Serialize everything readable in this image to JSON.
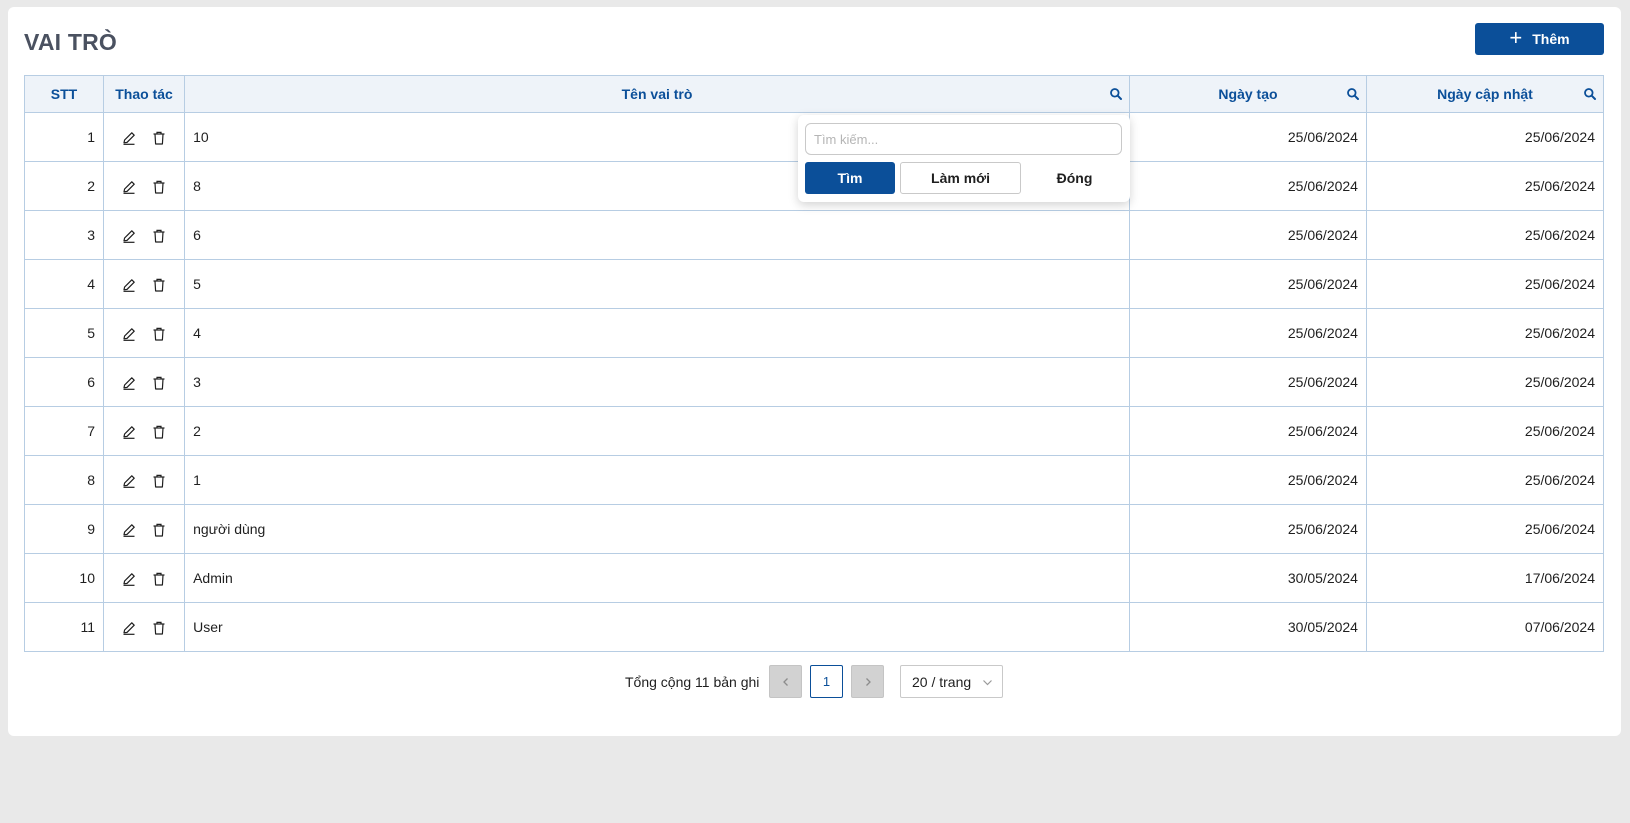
{
  "page": {
    "title": "VAI TRÒ",
    "add_label": "Thêm"
  },
  "table": {
    "columns": {
      "stt": "STT",
      "actions": "Thao tác",
      "name": "Tên vai trò",
      "created": "Ngày tạo",
      "updated": "Ngày cập nhật"
    },
    "rows": [
      {
        "stt": "1",
        "name": "10",
        "created": "25/06/2024",
        "updated": "25/06/2024"
      },
      {
        "stt": "2",
        "name": "8",
        "created": "25/06/2024",
        "updated": "25/06/2024"
      },
      {
        "stt": "3",
        "name": "6",
        "created": "25/06/2024",
        "updated": "25/06/2024"
      },
      {
        "stt": "4",
        "name": "5",
        "created": "25/06/2024",
        "updated": "25/06/2024"
      },
      {
        "stt": "5",
        "name": "4",
        "created": "25/06/2024",
        "updated": "25/06/2024"
      },
      {
        "stt": "6",
        "name": "3",
        "created": "25/06/2024",
        "updated": "25/06/2024"
      },
      {
        "stt": "7",
        "name": "2",
        "created": "25/06/2024",
        "updated": "25/06/2024"
      },
      {
        "stt": "8",
        "name": "1",
        "created": "25/06/2024",
        "updated": "25/06/2024"
      },
      {
        "stt": "9",
        "name": "người dùng",
        "created": "25/06/2024",
        "updated": "25/06/2024"
      },
      {
        "stt": "10",
        "name": "Admin",
        "created": "30/05/2024",
        "updated": "17/06/2024"
      },
      {
        "stt": "11",
        "name": "User",
        "created": "30/05/2024",
        "updated": "07/06/2024"
      }
    ]
  },
  "search_popover": {
    "placeholder": "Tìm kiếm...",
    "search_label": "Tìm",
    "reset_label": "Làm mới",
    "close_label": "Đóng"
  },
  "pagination": {
    "total_text": "Tổng cộng 11 bản ghi",
    "current_page": "1",
    "page_size": "20 / trang"
  },
  "icons": {
    "add": "plus-icon",
    "edit": "pencil-icon",
    "delete": "trash-icon",
    "column_search": "search-icon",
    "prev": "chevron-left-icon",
    "next": "chevron-right-icon",
    "page_size": "chevron-down-icon"
  },
  "colors": {
    "primary": "#0b4f99",
    "header_bg": "#eef3f9",
    "border": "#b7cde3",
    "background": "#e9e9e9"
  }
}
